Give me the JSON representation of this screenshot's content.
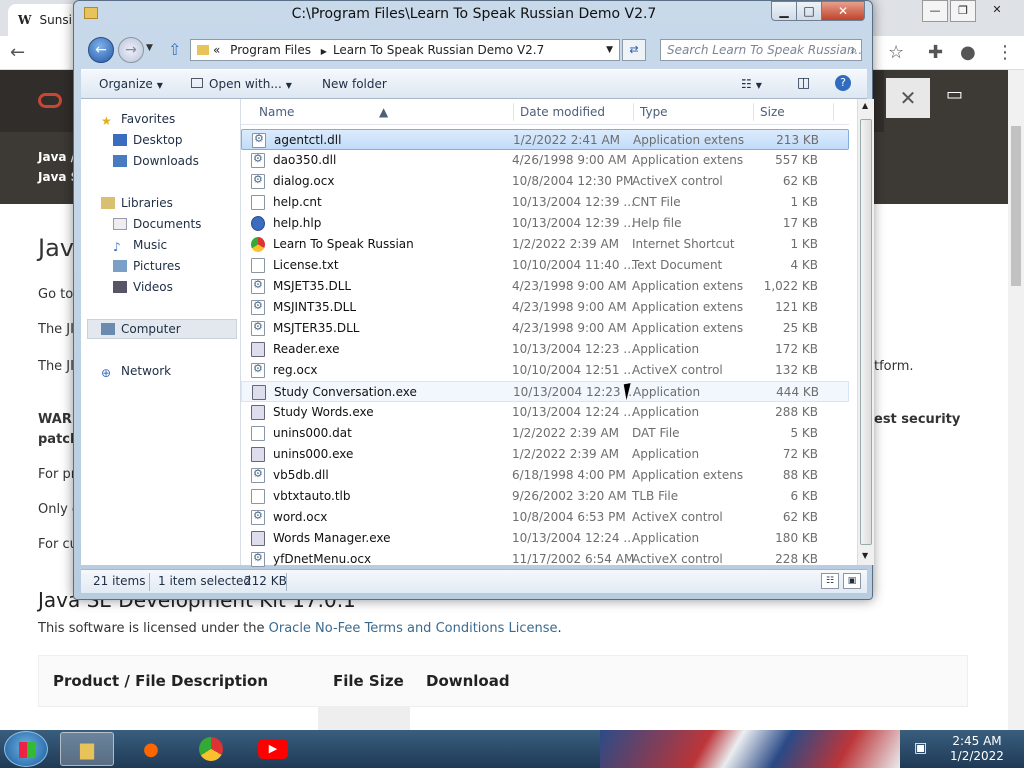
{
  "browser": {
    "tab_label": "Sunsi",
    "window_controls": [
      "—",
      "❐",
      "✕"
    ],
    "close_banner": "✕"
  },
  "website": {
    "breadcrumb1": "Java /",
    "breadcrumb2": "Java S",
    "heading_partial": "Jav",
    "lines": [
      "Go to",
      "The JI",
      "The JI",
      "WARN",
      "patch",
      "For pr",
      "Only c",
      "For cu"
    ],
    "right_fragments": [
      "tform.",
      "est security"
    ],
    "jdk_heading": "Java SE Development Kit 17.0.1",
    "license_text": "This software is licensed under the ",
    "license_link": "Oracle No-Fee Terms and Conditions License",
    "license_end": ".",
    "table_headers": [
      "Product / File Description",
      "File Size",
      "Download"
    ]
  },
  "explorer": {
    "title": "C:\\Program Files\\Learn To Speak Russian Demo V2.7",
    "address_prefix": "«",
    "address_segments": [
      "Program Files",
      "Learn To Speak Russian Demo V2.7"
    ],
    "search_placeholder": "Search Learn To Speak Russian...",
    "toolbar": {
      "organize": "Organize",
      "open_with": "Open with...",
      "new_folder": "New folder"
    },
    "nav": {
      "favorites": "Favorites",
      "desktop": "Desktop",
      "downloads": "Downloads",
      "libraries": "Libraries",
      "documents": "Documents",
      "music": "Music",
      "pictures": "Pictures",
      "videos": "Videos",
      "computer": "Computer",
      "network": "Network"
    },
    "columns": {
      "name": "Name",
      "date": "Date modified",
      "type": "Type",
      "size": "Size"
    },
    "files": [
      {
        "name": "agentctl.dll",
        "date": "1/2/2022 2:41 AM",
        "type": "Application extens...",
        "size": "213 KB",
        "icon": "gear"
      },
      {
        "name": "dao350.dll",
        "date": "4/26/1998 9:00 AM",
        "type": "Application extens...",
        "size": "557 KB",
        "icon": "gear"
      },
      {
        "name": "dialog.ocx",
        "date": "10/8/2004 12:30 PM",
        "type": "ActiveX control",
        "size": "62 KB",
        "icon": "gear"
      },
      {
        "name": "help.cnt",
        "date": "10/13/2004 12:39 ...",
        "type": "CNT File",
        "size": "1 KB",
        "icon": "file"
      },
      {
        "name": "help.hlp",
        "date": "10/13/2004 12:39 ...",
        "type": "Help file",
        "size": "17 KB",
        "icon": "blue"
      },
      {
        "name": "Learn To Speak Russian",
        "date": "1/2/2022 2:39 AM",
        "type": "Internet Shortcut",
        "size": "1 KB",
        "icon": "chrome"
      },
      {
        "name": "License.txt",
        "date": "10/10/2004 11:40 ...",
        "type": "Text Document",
        "size": "4 KB",
        "icon": "file"
      },
      {
        "name": "MSJET35.DLL",
        "date": "4/23/1998 9:00 AM",
        "type": "Application extens...",
        "size": "1,022 KB",
        "icon": "gear"
      },
      {
        "name": "MSJINT35.DLL",
        "date": "4/23/1998 9:00 AM",
        "type": "Application extens...",
        "size": "121 KB",
        "icon": "gear"
      },
      {
        "name": "MSJTER35.DLL",
        "date": "4/23/1998 9:00 AM",
        "type": "Application extens...",
        "size": "25 KB",
        "icon": "gear"
      },
      {
        "name": "Reader.exe",
        "date": "10/13/2004 12:23 ...",
        "type": "Application",
        "size": "172 KB",
        "icon": "exe"
      },
      {
        "name": "reg.ocx",
        "date": "10/10/2004 12:51 ...",
        "type": "ActiveX control",
        "size": "132 KB",
        "icon": "gear"
      },
      {
        "name": "Study Conversation.exe",
        "date": "10/13/2004 12:23 ...",
        "type": "Application",
        "size": "444 KB",
        "icon": "exe"
      },
      {
        "name": "Study Words.exe",
        "date": "10/13/2004 12:24 ...",
        "type": "Application",
        "size": "288 KB",
        "icon": "exe"
      },
      {
        "name": "unins000.dat",
        "date": "1/2/2022 2:39 AM",
        "type": "DAT File",
        "size": "5 KB",
        "icon": "file"
      },
      {
        "name": "unins000.exe",
        "date": "1/2/2022 2:39 AM",
        "type": "Application",
        "size": "72 KB",
        "icon": "exe"
      },
      {
        "name": "vb5db.dll",
        "date": "6/18/1998 4:00 PM",
        "type": "Application extens...",
        "size": "88 KB",
        "icon": "gear"
      },
      {
        "name": "vbtxtauto.tlb",
        "date": "9/26/2002 3:20 AM",
        "type": "TLB File",
        "size": "6 KB",
        "icon": "file"
      },
      {
        "name": "word.ocx",
        "date": "10/8/2004 6:53 PM",
        "type": "ActiveX control",
        "size": "62 KB",
        "icon": "gear"
      },
      {
        "name": "Words Manager.exe",
        "date": "10/13/2004 12:24 ...",
        "type": "Application",
        "size": "180 KB",
        "icon": "exe"
      },
      {
        "name": "yfDnetMenu.ocx",
        "date": "11/17/2002 6:54 AM",
        "type": "ActiveX control",
        "size": "228 KB",
        "icon": "gear"
      }
    ],
    "status": {
      "count": "21 items",
      "selected": "1 item selected",
      "size": "212 KB"
    }
  },
  "taskbar": {
    "time": "2:45 AM",
    "date": "1/2/2022"
  }
}
